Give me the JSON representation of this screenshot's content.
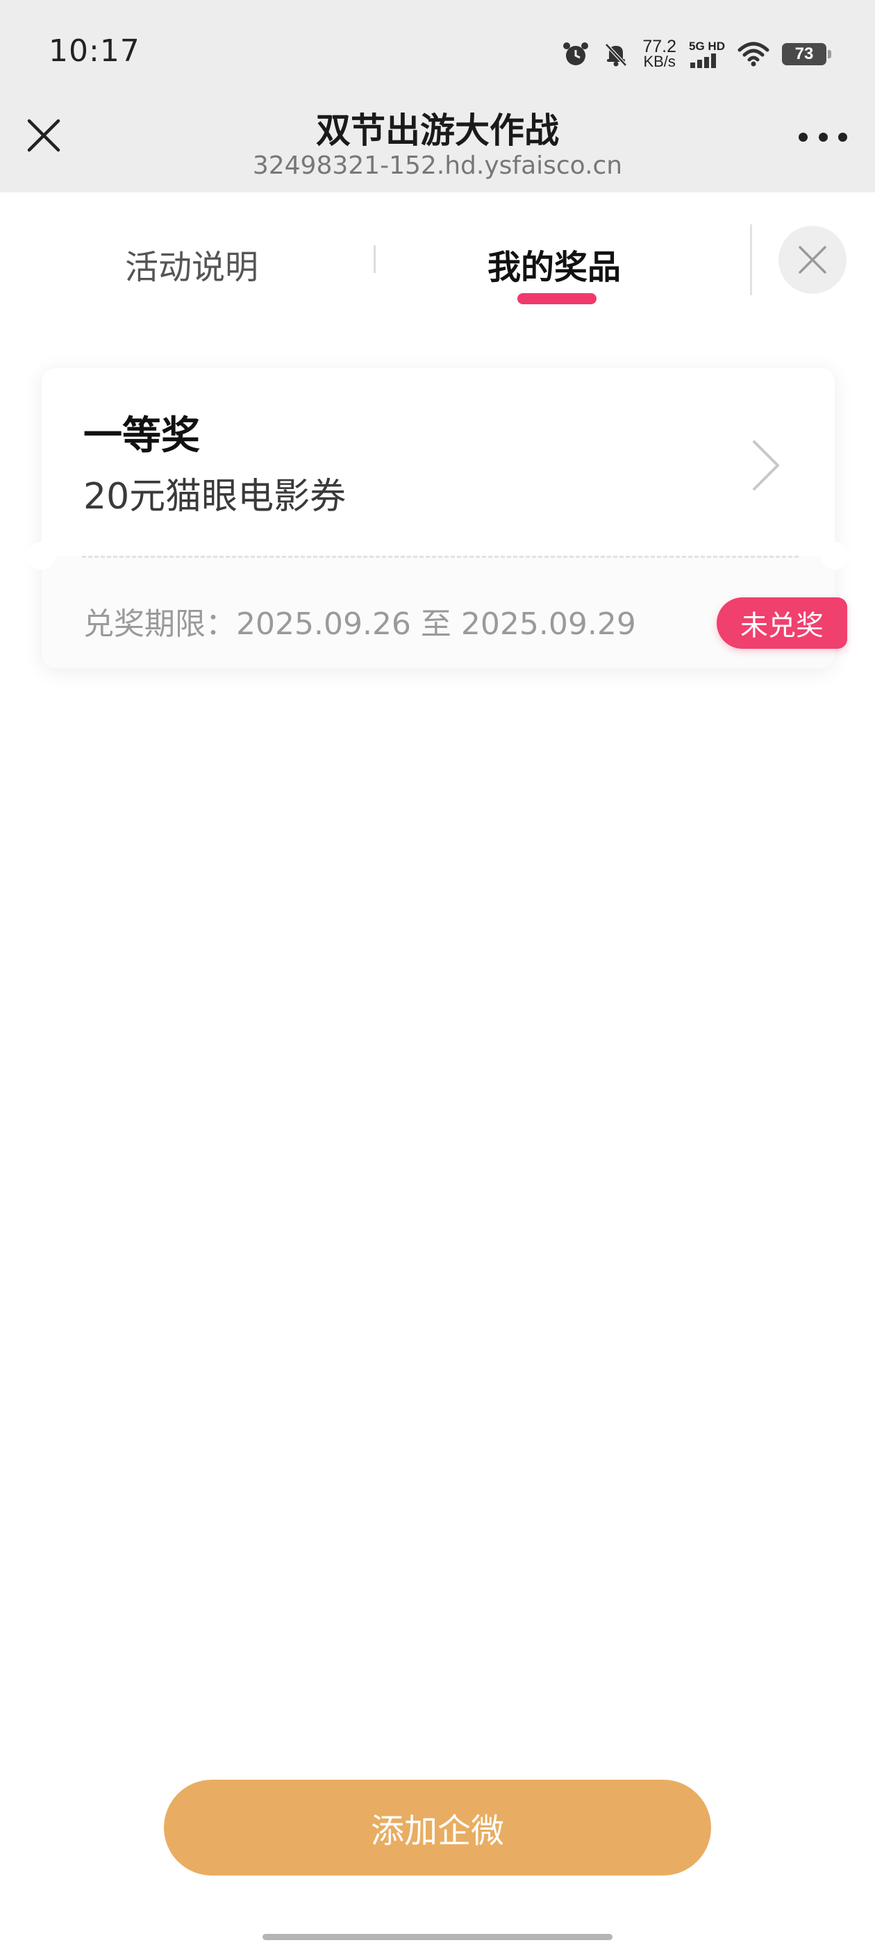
{
  "status_bar": {
    "time": "10:17",
    "net_speed_value": "77.2",
    "net_speed_unit": "KB/s",
    "signal_label": "5G HD",
    "battery": "73",
    "icons": [
      "alarm-icon",
      "mute-bell-icon",
      "signal-icon",
      "wifi-icon",
      "battery-icon"
    ]
  },
  "webview_header": {
    "title": "双节出游大作战",
    "url": "32498321-152.hd.ysfaisco.cn",
    "close_icon": "close-icon",
    "more_icon": "more-dots-icon"
  },
  "tabs": [
    {
      "label": "活动说明",
      "active": false
    },
    {
      "label": "我的奖品",
      "active": true
    }
  ],
  "prize_card": {
    "level": "一等奖",
    "name": "20元猫眼电影券",
    "validity_label": "兑奖期限：",
    "validity_range": "2025.09.26 至 2025.09.29",
    "status": "未兑奖",
    "arrow_icon": "chevron-right-icon"
  },
  "bottom_button": {
    "label": "添加企微"
  },
  "colors": {
    "accent_pink": "#f03a6c",
    "button_orange": "#e8ad62",
    "header_gray": "#ededed"
  }
}
